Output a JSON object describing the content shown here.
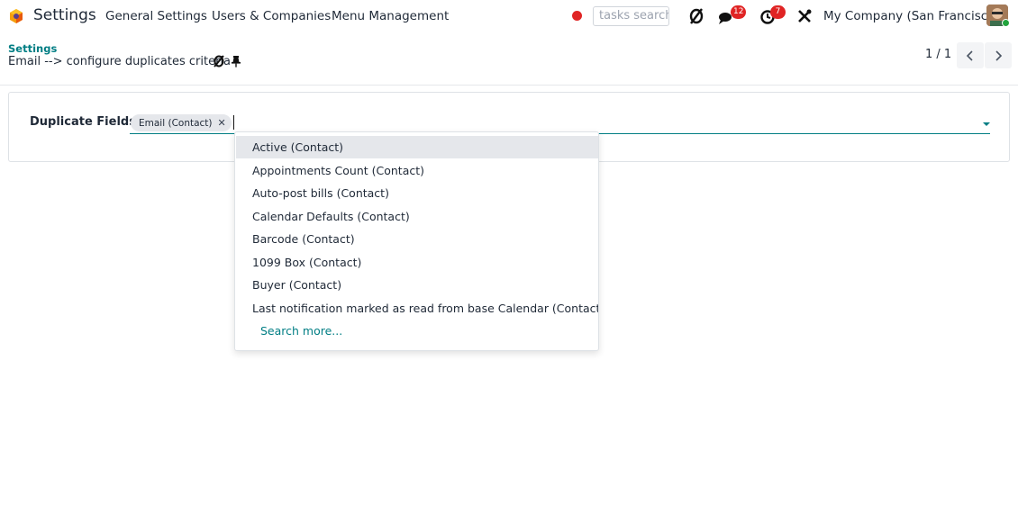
{
  "navbar": {
    "app_name": "Settings",
    "menus": [
      "General Settings",
      "Users & Companies",
      "Menu Management"
    ],
    "search_placeholder": "tasks search",
    "chat_count": "12",
    "activity_count": "7",
    "company": "My Company (San Francisco)"
  },
  "control_panel": {
    "breadcrumb_parent": "Settings",
    "record_title": "Email --> configure duplicates criteria",
    "pager_value": "1 / 1"
  },
  "form": {
    "field_label": "Duplicate Fields",
    "tags": [
      "Email (Contact)"
    ]
  },
  "dropdown": {
    "items": [
      "Active (Contact)",
      "Appointments Count (Contact)",
      "Auto-post bills (Contact)",
      "Calendar Defaults (Contact)",
      "Barcode (Contact)",
      "1099 Box (Contact)",
      "Buyer (Contact)",
      "Last notification marked as read from base Calendar (Contact)"
    ],
    "search_more": "Search more..."
  },
  "colors": {
    "accent": "#017e84",
    "badge": "#e02424",
    "online": "#22a33d"
  },
  "icons": [
    "settings-app-icon",
    "record-dot-icon",
    "debug-icon",
    "chat-icon",
    "activity-icon",
    "tools-icon",
    "gear-icon",
    "pin-icon",
    "chevron-left-icon",
    "chevron-right-icon",
    "close-icon",
    "caret-down-icon"
  ]
}
